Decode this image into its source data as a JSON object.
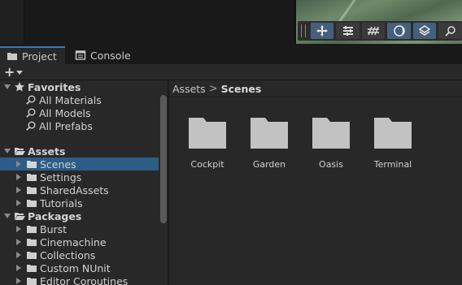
{
  "tabs": [
    {
      "label": "Project",
      "icon": "folder-icon",
      "active": true
    },
    {
      "label": "Console",
      "icon": "console-icon",
      "active": false
    }
  ],
  "toolbar": {
    "add_symbol": "+"
  },
  "favorites": {
    "label": "Favorites",
    "items": [
      "All Materials",
      "All Models",
      "All Prefabs"
    ]
  },
  "assets": {
    "label": "Assets",
    "items": [
      {
        "label": "Scenes",
        "selected": true
      },
      {
        "label": "Settings",
        "selected": false
      },
      {
        "label": "SharedAssets",
        "selected": false
      },
      {
        "label": "Tutorials",
        "selected": false
      }
    ]
  },
  "packages": {
    "label": "Packages",
    "items": [
      "Burst",
      "Cinemachine",
      "Collections",
      "Custom NUnit",
      "Editor Coroutines"
    ]
  },
  "breadcrumb": {
    "root": "Assets",
    "separator": ">",
    "current": "Scenes"
  },
  "content_items": [
    "Cockpit",
    "Garden",
    "Oasis",
    "Terminal"
  ],
  "colors": {
    "selection": "#2c5d87",
    "panel": "#282828",
    "folder": "#c2c2c2",
    "tool_button": "#46607c"
  }
}
